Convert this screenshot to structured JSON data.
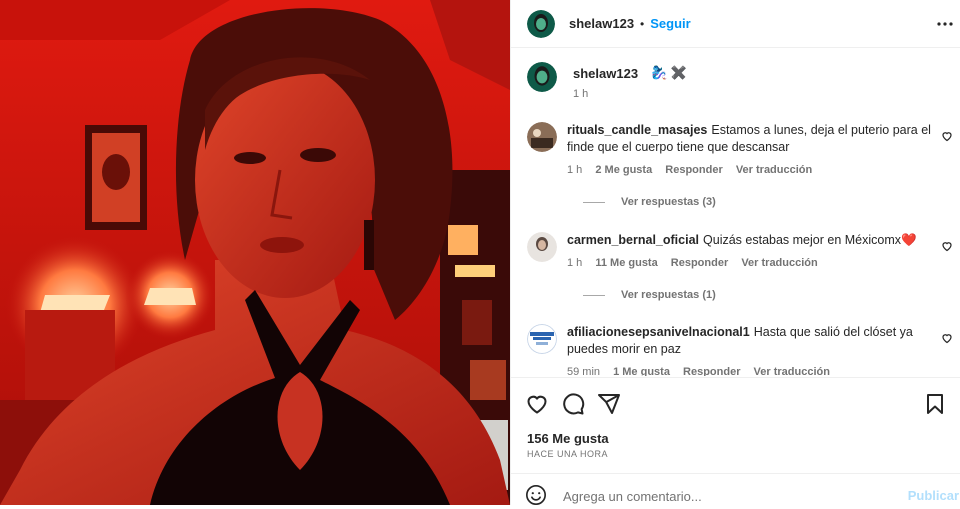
{
  "header": {
    "username": "shelaw123",
    "separator": "•",
    "follow_label": "Seguir"
  },
  "caption": {
    "username": "shelaw123",
    "emoji": "🧞‍♀️ ✖️",
    "time": "1 h"
  },
  "comments": [
    {
      "username": "rituals_candle_masajes",
      "text": "Estamos a lunes, deja el puterio para el finde que el cuerpo tiene que descansar",
      "time": "1 h",
      "likes": "2 Me gusta",
      "reply_label": "Responder",
      "translate_label": "Ver traducción",
      "replies_label": "Ver respuestas (3)"
    },
    {
      "username": "carmen_bernal_oficial",
      "text": "Quizás estabas mejor en Méxicomx❤️",
      "time": "1 h",
      "likes": "11 Me gusta",
      "reply_label": "Responder",
      "translate_label": "Ver traducción",
      "replies_label": "Ver respuestas (1)"
    },
    {
      "username": "afiliacionesepsanivelnacional1",
      "text": "Hasta que salió del clóset ya puedes morir en paz",
      "time": "59 min",
      "likes": "1 Me gusta",
      "reply_label": "Responder",
      "translate_label": "Ver traducción",
      "avatar_text": "SEGURIDAD SOCIAL"
    }
  ],
  "likes": "156 Me gusta",
  "post_time": "HACE UNA HORA",
  "add_comment": {
    "placeholder": "Agrega un comentario...",
    "post_label": "Publicar"
  },
  "icons": {
    "more": "more-horizontal-icon",
    "like": "heart-icon",
    "comment": "comment-icon",
    "share": "share-icon",
    "save": "bookmark-icon",
    "emoji": "emoji-icon"
  },
  "colors": {
    "accent": "#0095f6",
    "publish_disabled": "#b2dffc",
    "muted_text": "#737373",
    "photo_red": "#c2100c"
  }
}
